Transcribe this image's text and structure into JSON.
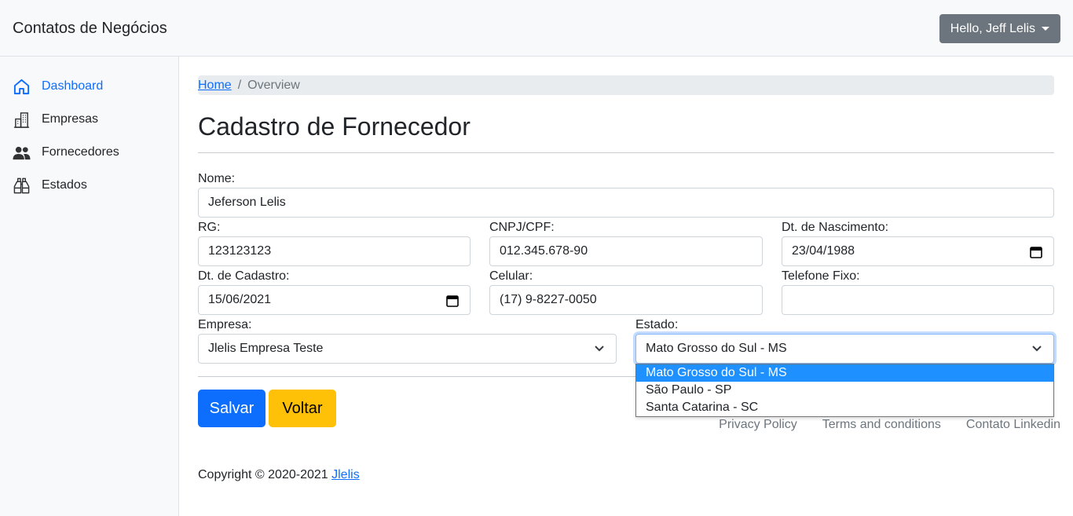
{
  "navbar": {
    "brand": "Contatos de Negócios",
    "user_label": "Hello, Jeff Lelis"
  },
  "sidebar": {
    "items": [
      {
        "label": "Dashboard",
        "icon": "home-icon",
        "active": true
      },
      {
        "label": "Empresas",
        "icon": "building-icon"
      },
      {
        "label": "Fornecedores",
        "icon": "people-icon"
      },
      {
        "label": "Estados",
        "icon": "binoculars-icon"
      }
    ]
  },
  "breadcrumb": {
    "home": "Home",
    "separator": "/",
    "current": "Overview"
  },
  "page": {
    "title": "Cadastro de Fornecedor"
  },
  "form": {
    "nome": {
      "label": "Nome:",
      "value": "Jeferson Lelis"
    },
    "rg": {
      "label": "RG:",
      "value": "123123123"
    },
    "cnpj": {
      "label": "CNPJ/CPF:",
      "value": "012.345.678-90"
    },
    "nascimento": {
      "label": "Dt. de Nascimento:",
      "value": "23/04/1988"
    },
    "cadastro": {
      "label": "Dt. de Cadastro:",
      "value": "15/06/2021"
    },
    "celular": {
      "label": "Celular:",
      "value": "(17) 9-8227-0050"
    },
    "telefone": {
      "label": "Telefone Fixo:",
      "value": ""
    },
    "empresa": {
      "label": "Empresa:",
      "value": "Jlelis Empresa Teste"
    },
    "estado": {
      "label": "Estado:",
      "value": "Mato Grosso do Sul - MS",
      "options": [
        "Mato Grosso do Sul - MS",
        "São Paulo - SP",
        "Santa Catarina - SC"
      ]
    }
  },
  "buttons": {
    "save": "Salvar",
    "back": "Voltar"
  },
  "footer": {
    "copyright": "Copyright © 2020-2021",
    "author_link": "Jlelis",
    "links": [
      "Privacy Policy",
      "Terms and conditions",
      "Contato Linkedin"
    ]
  },
  "colors": {
    "primary": "#0d6efd",
    "warning": "#ffc107",
    "secondary": "#6c757d",
    "selected_option": "#1e90ff"
  }
}
